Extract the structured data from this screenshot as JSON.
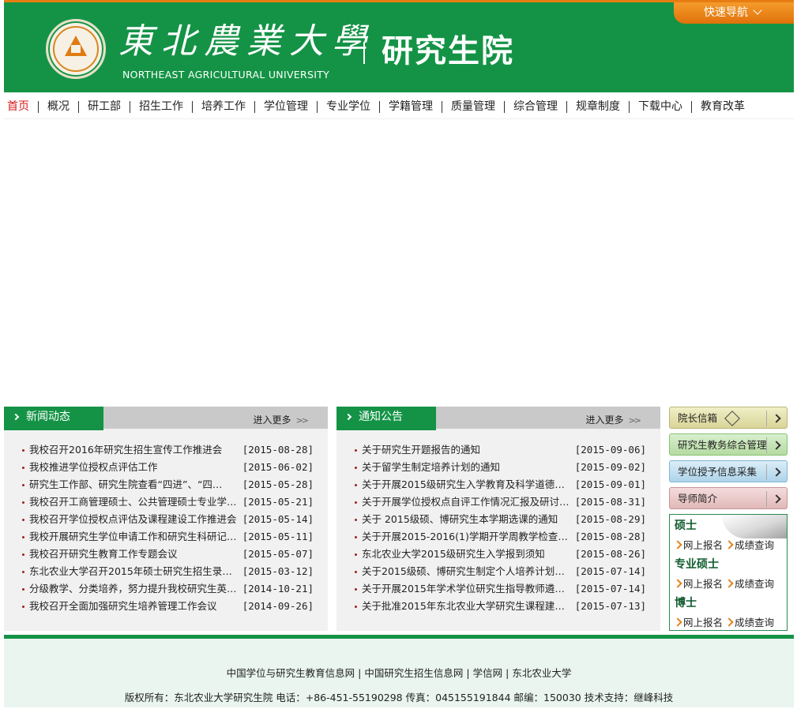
{
  "header": {
    "quick_nav": "快速导航",
    "brand_cn": "東北農業大學",
    "brand_en": "NORTHEAST AGRICULTURAL UNIVERSITY",
    "graduate_school": "研究生院",
    "seal_text": "NORTHEAST AGRICULTURAL UNIVERSITY 1948",
    "accent_color": "#149346",
    "orange_color": "#e77d12"
  },
  "nav": {
    "items": [
      "首页",
      "概况",
      "研工部",
      "招生工作",
      "培养工作",
      "学位管理",
      "专业学位",
      "学籍管理",
      "质量管理",
      "综合管理",
      "规章制度",
      "下载中心",
      "教育改革"
    ]
  },
  "news": {
    "title": "新闻动态",
    "more": "进入更多",
    "items": [
      {
        "title": "我校召开2016年研究生招生宣传工作推进会",
        "date": "[2015-08-28]"
      },
      {
        "title": "我校推进学位授权点评估工作",
        "date": "[2015-06-02]"
      },
      {
        "title": "研究生工作部、研究生院查看“四进”、“四…",
        "date": "[2015-05-28]"
      },
      {
        "title": "我校召开工商管理硕士、公共管理硕士专业学…",
        "date": "[2015-05-21]"
      },
      {
        "title": "我校召开学位授权点评估及课程建设工作推进会",
        "date": "[2015-05-14]"
      },
      {
        "title": "我校开展研究生学位申请工作和研究生科研记…",
        "date": "[2015-05-11]"
      },
      {
        "title": "我校召开研究生教育工作专题会议",
        "date": "[2015-05-07]"
      },
      {
        "title": "东北农业大学召开2015年硕士研究生招生录取…",
        "date": "[2015-03-12]"
      },
      {
        "title": "分级教学、分类培养，努力提升我校研究生英…",
        "date": "[2014-10-21]"
      },
      {
        "title": "我校召开全面加强研究生培养管理工作会议",
        "date": "[2014-09-26]"
      }
    ]
  },
  "notice": {
    "title": "通知公告",
    "more": "进入更多",
    "items": [
      {
        "title": "关于研究生开题报告的通知",
        "date": "[2015-09-06]"
      },
      {
        "title": "关于留学生制定培养计划的通知",
        "date": "[2015-09-02]"
      },
      {
        "title": "关于开展2015级研究生入学教育及科学道德和…",
        "date": "[2015-09-01]"
      },
      {
        "title": "关于开展学位授权点自评工作情况汇报及研讨…",
        "date": "[2015-08-31]"
      },
      {
        "title": "关于 2015级硕、博研究生本学期选课的通知",
        "date": "[2015-08-29]"
      },
      {
        "title": "关于开展2015-2016(1)学期开学周教学检查工…",
        "date": "[2015-08-28]"
      },
      {
        "title": "东北农业大学2015级研究生入学报到须知",
        "date": "[2015-08-26]"
      },
      {
        "title": "关于2015级硕、博研究生制定个人培养计划的…",
        "date": "[2015-07-14]"
      },
      {
        "title": "关于开展2015年学术学位研究生指导教师遴选…",
        "date": "[2015-07-14]"
      },
      {
        "title": "关于批准2015年东北农业大学研究生课程建设…",
        "date": "[2015-07-13]"
      }
    ]
  },
  "sidebar": {
    "president_mailbox": "院长信箱",
    "affairs_system": "研究生教务综合管理",
    "degree_info": "学位授予信息采集",
    "tutor_intro": "导师简介",
    "admission": [
      {
        "title": "硕士",
        "apply": "网上报名",
        "score": "成绩查询"
      },
      {
        "title": "专业硕士",
        "apply": "网上报名",
        "score": "成绩查询"
      },
      {
        "title": "博士",
        "apply": "网上报名",
        "score": "成绩查询"
      }
    ]
  },
  "footer": {
    "links": [
      "中国学位与研究生教育信息网",
      "中国研究生招生信息网",
      "学信网",
      "东北农业大学"
    ],
    "link_sep": "|",
    "copyright": "版权所有：东北农业大学研究生院 电话：+86-451-55190298 传真：045155191844 邮编：150030 技术支持：继峰科技"
  }
}
